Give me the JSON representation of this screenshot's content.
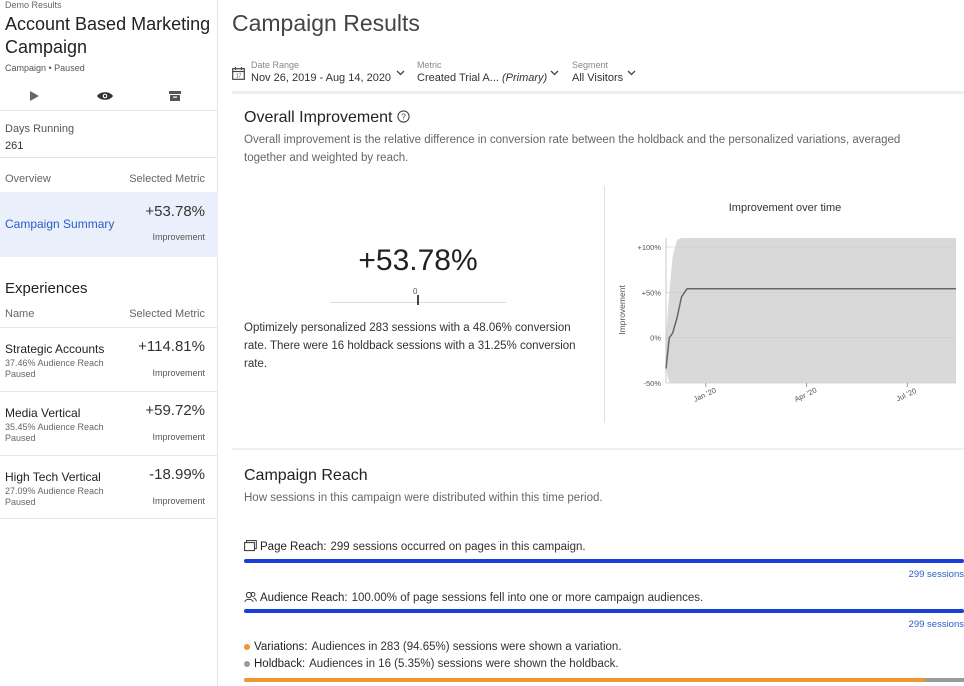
{
  "sidebar": {
    "demo_label": "Demo Results",
    "campaign_title": "Account Based Marketing Campaign",
    "status": "Campaign • Paused",
    "days_running_label": "Days Running",
    "days_running_value": "261",
    "overview_label": "Overview",
    "selected_metric_label": "Selected Metric",
    "summary": {
      "name": "Campaign Summary",
      "value": "+53.78%",
      "sub": "Improvement"
    },
    "experiences_title": "Experiences",
    "name_label": "Name",
    "experiences": [
      {
        "name": "Strategic Accounts",
        "reach": "37.46% Audience Reach",
        "status": "Paused",
        "value": "+114.81%",
        "sub": "Improvement"
      },
      {
        "name": "Media Vertical",
        "reach": "35.45% Audience Reach",
        "status": "Paused",
        "value": "+59.72%",
        "sub": "Improvement"
      },
      {
        "name": "High Tech Vertical",
        "reach": "27.09% Audience Reach",
        "status": "Paused",
        "value": "-18.99%",
        "sub": "Improvement"
      }
    ]
  },
  "main": {
    "title": "Campaign Results",
    "filters": {
      "date_label": "Date Range",
      "date_value": "Nov 26, 2019 - Aug 14, 2020",
      "metric_label": "Metric",
      "metric_value": "Created Trial A...",
      "metric_primary": "(Primary)",
      "segment_label": "Segment",
      "segment_value": "All Visitors"
    },
    "overall": {
      "title": "Overall Improvement",
      "description": "Overall improvement is the relative difference in conversion rate between the holdback and the personalized variations, averaged together and weighted by reach.",
      "value": "+53.78%",
      "zero": "0",
      "summary": "Optimizely personalized 283 sessions with a 48.06% conversion rate. There were 16 holdback sessions with a 31.25% conversion rate."
    },
    "reach": {
      "title": "Campaign Reach",
      "description": "How sessions in this campaign were distributed within this time period.",
      "page_bold": "Page Reach:",
      "page_text": "299 sessions occurred on pages in this campaign.",
      "page_sessions": "299 sessions",
      "audience_bold": "Audience Reach:",
      "audience_text": "100.00% of page sessions fell into one or more campaign audiences.",
      "audience_sessions": "299 sessions",
      "variations_bold": "Variations:",
      "variations_text": "Audiences in 283 (94.65%) sessions were shown a variation.",
      "holdback_bold": "Holdback:",
      "holdback_text": "Audiences in 16 (5.35%) sessions were shown the holdback.",
      "variations_share": 0.9465
    }
  },
  "chart_data": {
    "type": "line",
    "title": "Improvement over time",
    "ylabel": "Improvement",
    "xlabel": "",
    "ylim": [
      -50,
      110
    ],
    "yticks": [
      "+100%",
      "+50%",
      "0%",
      "-50%"
    ],
    "ytick_values": [
      100,
      50,
      0,
      -50
    ],
    "xticks": [
      "Jan '20",
      "Apr '20",
      "Jul '20"
    ],
    "series": [
      {
        "x": [
          "2019-11-26",
          "2019-11-29",
          "2019-12-02",
          "2019-12-06",
          "2019-12-10",
          "2019-12-15",
          "2020-01-01",
          "2020-08-14"
        ],
        "values": [
          -34,
          0,
          5,
          22,
          45,
          54,
          54,
          54
        ]
      }
    ],
    "confidence_band": {
      "upper": [
        0,
        50,
        90,
        108,
        110,
        110,
        110,
        110
      ],
      "lower": [
        -34,
        -50,
        -50,
        -50,
        -50,
        -50,
        -50,
        -50
      ]
    },
    "colors": {
      "line": "#666666",
      "band": "#d9d9d9",
      "page_bar": "#1a3fd6",
      "variations": "#f0962e",
      "holdback": "#9a9a9a",
      "link": "#2b5cc4"
    }
  }
}
